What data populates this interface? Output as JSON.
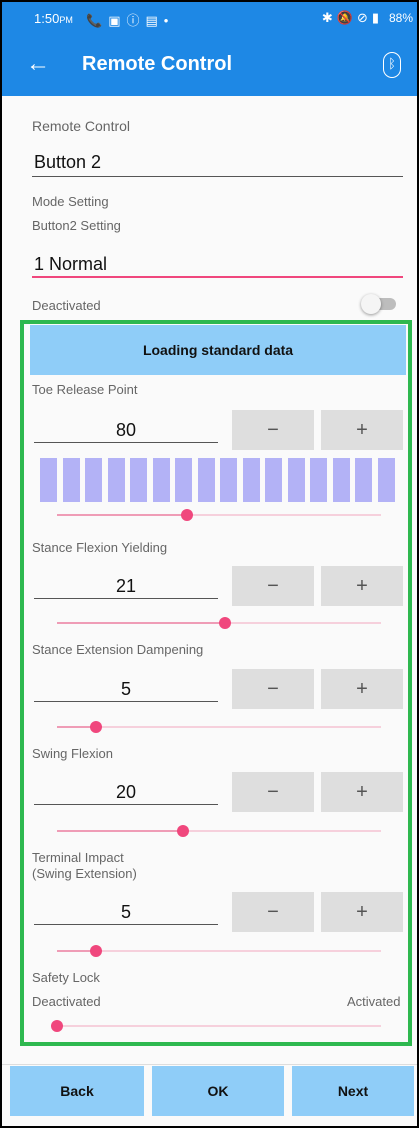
{
  "status_bar": {
    "time": "1:50",
    "ampm": "PM",
    "left_icons": [
      "phone-icon",
      "image-icon",
      "info-icon",
      "calendar-icon",
      "dot-icon"
    ],
    "right_icons": [
      "bluetooth-icon",
      "mute-icon",
      "no-sim-icon",
      "battery-icon"
    ],
    "battery": "88%"
  },
  "app_bar": {
    "title": "Remote Control",
    "back_icon": "arrow-left-icon",
    "right_icon": "bluetooth-icon"
  },
  "form": {
    "remote_control_label": "Remote Control",
    "button_value": "Button 2",
    "mode_setting_label": "Mode Setting",
    "button_setting_label": "Button2 Setting",
    "mode_value": "1 Normal",
    "deactivated_label": "Deactivated",
    "toggle_on": false
  },
  "load_button": "Loading standard data",
  "params": [
    {
      "id": "toe",
      "label": "Toe Release Point",
      "value": "80",
      "slider_fraction": 0.4
    },
    {
      "id": "stance-flex",
      "label": "Stance Flexion Yielding",
      "value": "21",
      "slider_fraction": 0.52
    },
    {
      "id": "stance-ext",
      "label": "Stance Extension Dampening",
      "value": "5",
      "slider_fraction": 0.12
    },
    {
      "id": "swing-flex",
      "label": "Swing Flexion",
      "value": "20",
      "slider_fraction": 0.39
    },
    {
      "id": "terminal",
      "label": "Terminal Impact",
      "label2": "(Swing Extension)",
      "value": "5",
      "slider_fraction": 0.12
    }
  ],
  "stepper": {
    "minus": "−",
    "plus": "+"
  },
  "toe_bars_count": 16,
  "safety_lock": {
    "label": "Safety Lock",
    "left_label": "Deactivated",
    "right_label": "Activated",
    "slider_fraction": 0.0
  },
  "bottom": {
    "back": "Back",
    "ok": "OK",
    "next": "Next"
  },
  "colors": {
    "primary": "#1e88e5",
    "accent_pink": "#f0477d",
    "button_blue": "#8fcdf8",
    "green_border": "#2eb84f",
    "bar_purple": "#b3b2f6"
  }
}
